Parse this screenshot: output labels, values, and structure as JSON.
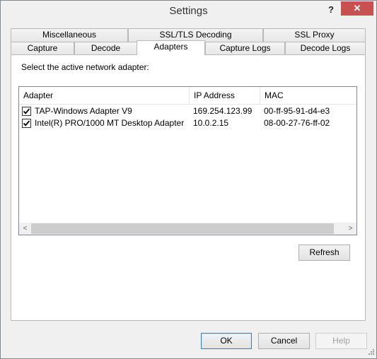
{
  "window": {
    "title": "Settings"
  },
  "titlebar": {
    "help_label": "?",
    "close_label": "✕"
  },
  "tabs": {
    "row1": [
      {
        "label": "Miscellaneous"
      },
      {
        "label": "SSL/TLS Decoding"
      },
      {
        "label": "SSL Proxy"
      }
    ],
    "row2": [
      {
        "label": "Capture"
      },
      {
        "label": "Decode"
      },
      {
        "label": "Adapters",
        "active": true
      },
      {
        "label": "Capture Logs"
      },
      {
        "label": "Decode Logs"
      }
    ]
  },
  "adapters_panel": {
    "instruction": "Select the active network adapter:",
    "columns": [
      "Adapter",
      "IP Address",
      "MAC"
    ],
    "rows": [
      {
        "checked": true,
        "adapter": "TAP-Windows Adapter V9",
        "ip": "169.254.123.99",
        "mac": "00-ff-95-91-d4-e3"
      },
      {
        "checked": true,
        "adapter": "Intel(R) PRO/1000 MT Desktop Adapter",
        "ip": "10.0.2.15",
        "mac": "08-00-27-76-ff-02"
      }
    ],
    "scroll_left": "<",
    "scroll_right": ">",
    "refresh_label": "Refresh"
  },
  "footer": {
    "ok_label": "OK",
    "cancel_label": "Cancel",
    "help_label": "Help"
  },
  "colors": {
    "close_button": "#c75050",
    "default_button_border": "#3c7fb1",
    "list_border": "#828790"
  }
}
